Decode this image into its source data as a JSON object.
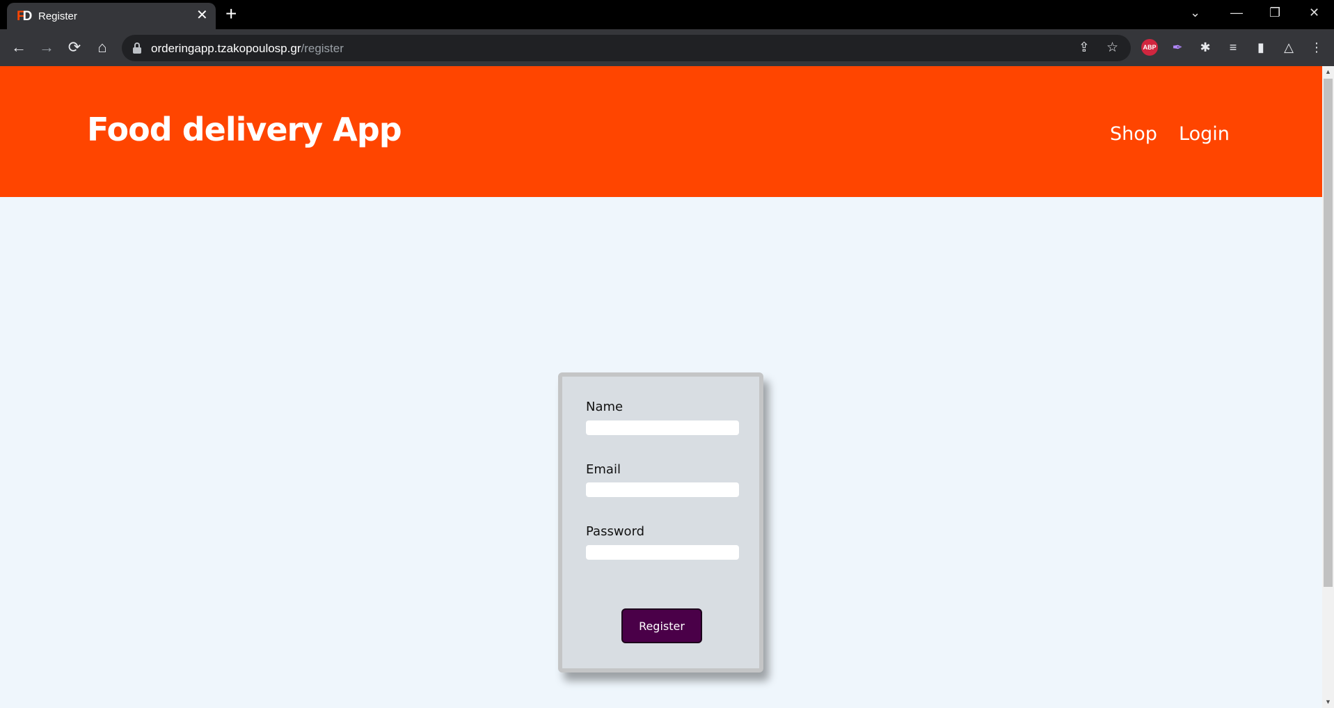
{
  "browser": {
    "tab": {
      "title": "Register",
      "favicon_f": "F",
      "favicon_d": "D"
    },
    "url": {
      "host": "orderingapp.tzakopoulosp.gr",
      "path": "/register"
    },
    "icons": {
      "back": "←",
      "forward": "→",
      "reload": "⟳",
      "home": "⌂",
      "share": "⇪",
      "star": "☆",
      "abp": "ABP",
      "feather": "✒",
      "puzzle": "✱",
      "media": "≡",
      "sidepanel": "▮",
      "drive": "△",
      "menu": "⋮",
      "close": "✕",
      "plus": "+",
      "chevron": "⌄",
      "minimize": "—",
      "restore": "❐"
    }
  },
  "header": {
    "brand": "Food delivery App",
    "nav": {
      "shop": "Shop",
      "login": "Login"
    }
  },
  "form": {
    "name_label": "Name",
    "email_label": "Email",
    "password_label": "Password",
    "name_value": "",
    "email_value": "",
    "password_value": "",
    "submit_label": "Register"
  },
  "colors": {
    "brand": "#ff4500",
    "page_bg": "#eff6fc",
    "card_bg": "#d8dde2",
    "button_bg": "#4a0048"
  }
}
